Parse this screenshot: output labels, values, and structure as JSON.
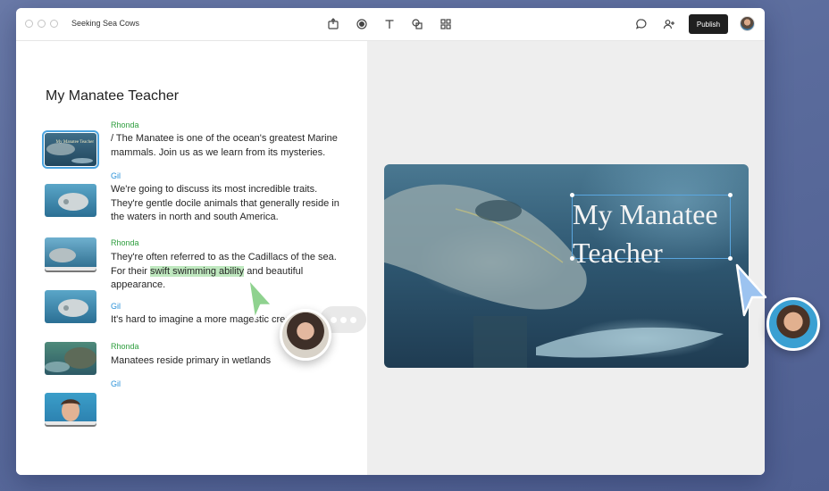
{
  "window": {
    "document_title": "Seeking Sea Cows",
    "publish_label": "Publish"
  },
  "toolbar": {
    "tools": [
      "export-icon",
      "record-icon",
      "text-icon",
      "shapes-icon",
      "grid-icon"
    ],
    "right_icons": [
      "comment-icon",
      "add-user-icon"
    ]
  },
  "script": {
    "title": "My Manatee Teacher",
    "blocks": [
      {
        "speaker": "Rhonda",
        "text": "/ The Manatee is one of the ocean's greatest Marine mammals. Join us as we learn from its mysteries.",
        "thumb_title": "My Manatee Teacher"
      },
      {
        "speaker": "Gil",
        "text": "We're going to discuss its most incredible traits. They're gentle docile animals that generally reside in the waters in north and south America."
      },
      {
        "speaker": "Rhonda",
        "text_before": "They're often referred to as the Cadillacs of the sea. For their ",
        "highlight": "swift swimming ability",
        "text_after": " and beautiful appearance."
      },
      {
        "speaker": "Gil",
        "text": "It's hard to imagine a more magestic crea"
      },
      {
        "speaker": "Rhonda",
        "text": "Manatees reside primary in wetlands"
      },
      {
        "speaker": "Gil",
        "text": ""
      }
    ]
  },
  "slide": {
    "title_line1": "My Manatee",
    "title_line2": "Teacher"
  },
  "colors": {
    "speaker_rhonda": "#2e9e3e",
    "speaker_gil": "#2a91d8",
    "highlight": "#bfe8bf",
    "cursor_green": "#8fd28f",
    "cursor_blue": "#9cc3f0",
    "selection": "#5aa6df"
  }
}
